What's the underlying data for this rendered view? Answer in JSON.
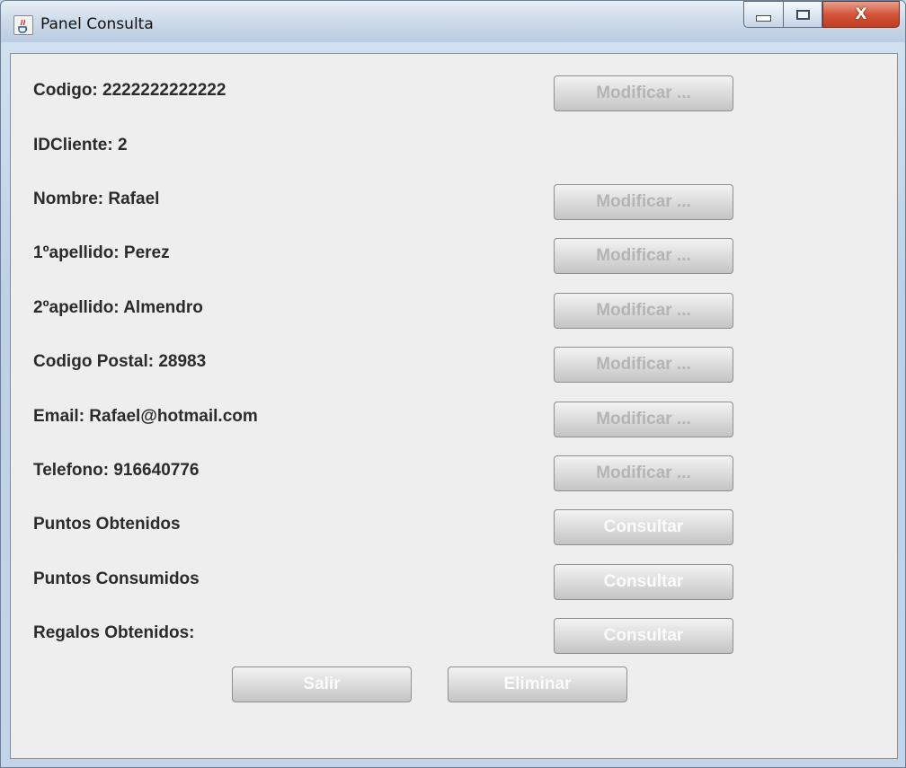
{
  "window": {
    "title": "Panel Consulta",
    "close_glyph": "X"
  },
  "fields": [
    {
      "label": "Codigo: 2222222222222",
      "button": "Modificar ..."
    },
    {
      "label": "IDCliente: 2",
      "button": null
    },
    {
      "label": "Nombre: Rafael",
      "button": "Modificar ..."
    },
    {
      "label": "1ºapellido: Perez",
      "button": "Modificar ..."
    },
    {
      "label": "2ºapellido: Almendro",
      "button": "Modificar ..."
    },
    {
      "label": "Codigo Postal: 28983",
      "button": "Modificar ..."
    },
    {
      "label": "Email: Rafael@hotmail.com",
      "button": "Modificar ..."
    },
    {
      "label": "Telefono: 916640776",
      "button": "Modificar ..."
    },
    {
      "label": "Puntos Obtenidos",
      "button": "Consultar"
    },
    {
      "label": "Puntos Consumidos",
      "button": "Consultar"
    },
    {
      "label": "Regalos Obtenidos:",
      "button": "Consultar"
    }
  ],
  "actions": {
    "exit_label": "Salir",
    "delete_label": "Eliminar"
  },
  "colors": {
    "disabled_text": "#b4b4b4",
    "label_text": "#2b2b2b",
    "panel_bg": "#eeeeee",
    "close_red": "#c23d22"
  },
  "icons": {
    "app_icon": "java-cup-icon",
    "minimize": "minimize-icon",
    "maximize": "maximize-icon",
    "close": "close-icon"
  }
}
